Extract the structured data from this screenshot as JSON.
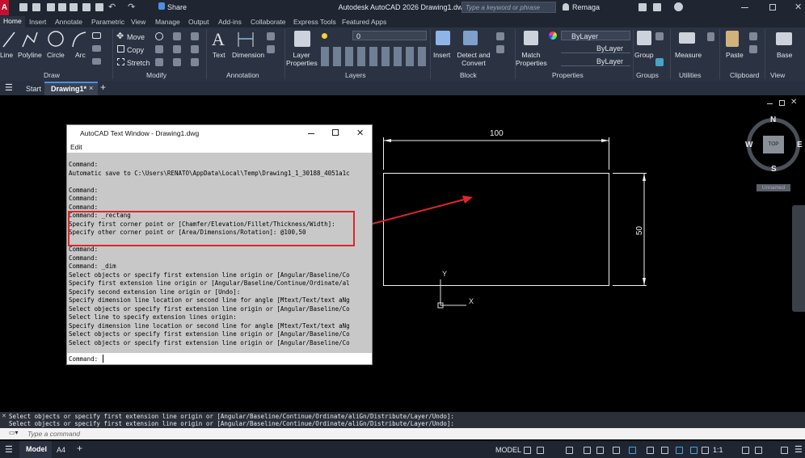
{
  "titlebar": {
    "title": "Autodesk AutoCAD 2026    Drawing1.dwg",
    "share": "Share",
    "search_placeholder": "Type a keyword or phrase",
    "user": "Remaga",
    "logo": "A"
  },
  "ribbon_tabs": [
    "Home",
    "Insert",
    "Annotate",
    "Parametric",
    "View",
    "Manage",
    "Output",
    "Add-ins",
    "Collaborate",
    "Express Tools",
    "Featured Apps"
  ],
  "draw": {
    "line": "Line",
    "polyline": "Polyline",
    "circle": "Circle",
    "arc": "Arc",
    "panel": "Draw"
  },
  "modify": {
    "move": "Move",
    "copy": "Copy",
    "stretch": "Stretch",
    "panel": "Modify"
  },
  "annotation": {
    "text": "Text",
    "dimension": "Dimension",
    "panel": "Annotation"
  },
  "layers": {
    "props": "Layer Properties",
    "current": "0",
    "panel": "Layers"
  },
  "block": {
    "insert": "Insert",
    "detect": "Detect and Convert",
    "panel": "Block"
  },
  "properties": {
    "match": "Match Properties",
    "bylayer1": "ByLayer",
    "bylayer2": "ByLayer",
    "bylayer3": "ByLayer",
    "panel": "Properties"
  },
  "groups": {
    "group": "Group",
    "panel": "Groups"
  },
  "utilities": {
    "measure": "Measure",
    "panel": "Utilities"
  },
  "clipboard": {
    "paste": "Paste",
    "panel": "Clipboard"
  },
  "view": {
    "base": "Base",
    "panel": "View"
  },
  "doctabs": {
    "start": "Start",
    "drawing": "Drawing1*"
  },
  "textwindow": {
    "title": "AutoCAD Text Window - Drawing1.dwg",
    "menu": "Edit",
    "lines": [
      "Command:",
      "Automatic save to C:\\Users\\RENATO\\AppData\\Local\\Temp\\Drawing1_1_30188_4051a1c",
      "",
      "Command:",
      "Command:",
      "Command:",
      "Command: _rectang",
      "Specify first corner point or [Chamfer/Elevation/Fillet/Thickness/Width]:",
      "Specify other corner point or [Area/Dimensions/Rotation]: @100,50",
      "",
      "Command:",
      "Command:",
      "Command: _dim",
      "Select objects or specify first extension line origin or [Angular/Baseline/Co",
      "Specify first extension line origin or [Angular/Baseline/Continue/Ordinate/al",
      "Specify second extension line origin or [Undo]:",
      "Specify dimension line location or second line for angle [Mtext/Text/text aNg",
      "Select objects or specify first extension line origin or [Angular/Baseline/Co",
      "Select line to specify extension lines origin:",
      "Specify dimension line location or second line for angle [Mtext/Text/text aNg",
      "Select objects or specify first extension line origin or [Angular/Baseline/Co",
      "Select objects or specify first extension line origin or [Angular/Baseline/Co"
    ],
    "input": "Command: "
  },
  "drawing": {
    "dim_width": "100",
    "dim_height": "50",
    "ucs_x": "X",
    "ucs_y": "Y"
  },
  "viewcube": {
    "n": "N",
    "s": "S",
    "e": "E",
    "w": "W",
    "top": "TOP",
    "ucs": "Unnamed"
  },
  "command_history": [
    "Select objects or specify first extension line origin or [Angular/Baseline/Continue/Ordinate/aliGn/Distribute/Layer/Undo]:",
    "Select objects or specify first extension line origin or [Angular/Baseline/Continue/Ordinate/aliGn/Distribute/Layer/Undo]:"
  ],
  "command_placeholder": "Type a command",
  "status": {
    "model_tab": "Model",
    "layout_tab": "A4",
    "model": "MODEL",
    "scale": "1:1"
  },
  "colors": {
    "highlight": "#e0262a",
    "ribbon": "#2b3342",
    "title": "#1f2632"
  }
}
